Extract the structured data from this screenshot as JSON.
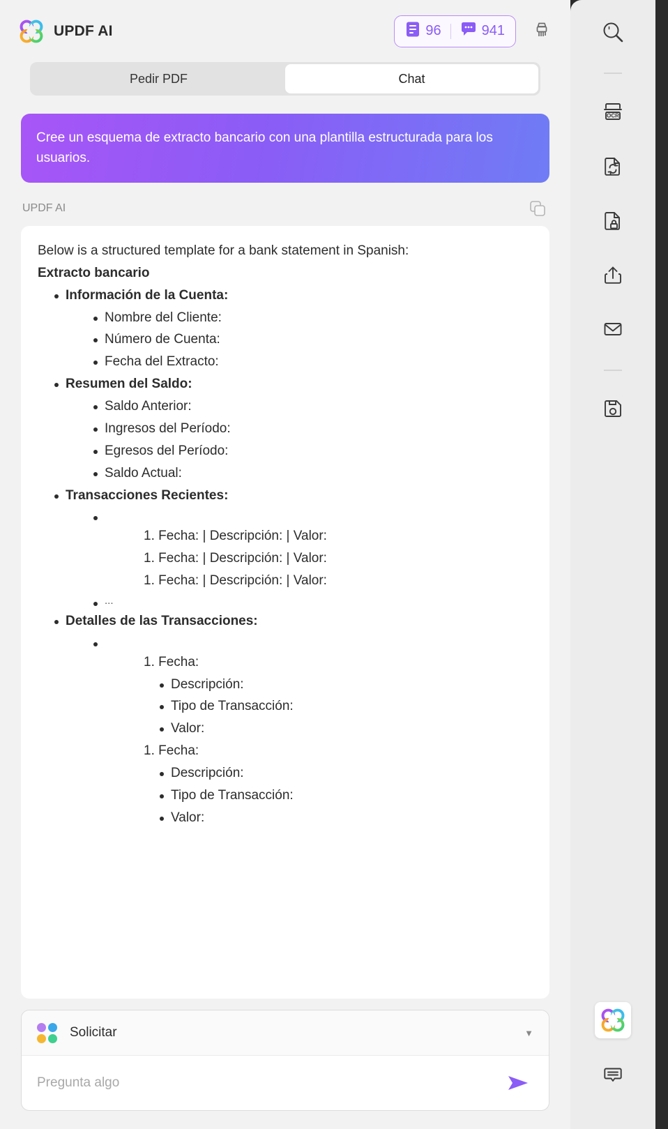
{
  "header": {
    "brand_title": "UPDF AI",
    "logo_icon": "updf-flower-logo",
    "pages_count": "96",
    "pages_icon": "document-pages-icon",
    "messages_count": "941",
    "messages_icon": "chat-bubble-icon",
    "brush_icon": "clear-brush-icon"
  },
  "tabs": [
    {
      "label": "Pedir PDF",
      "active": false
    },
    {
      "label": "Chat",
      "active": true
    }
  ],
  "conversation": {
    "user_message": "Cree un esquema de extracto bancario con una plantilla estructurada para los usuarios.",
    "response_author": "UPDF AI",
    "copy_icon": "copy-icon",
    "response": {
      "intro": "Below is a structured template for a bank statement in Spanish:",
      "heading": "Extracto bancario",
      "section1_title": "Información de la Cuenta:",
      "section1_items": [
        "Nombre del Cliente:",
        "Número de Cuenta:",
        "Fecha del Extracto:"
      ],
      "section2_title": "Resumen del Saldo:",
      "section2_items": [
        "Saldo Anterior:",
        "Ingresos del Período:",
        "Egresos del Período:",
        "Saldo Actual:"
      ],
      "section3_title": "Transacciones Recientes:",
      "section3_rows": [
        "1. Fecha: | Descripción: | Valor:",
        "1. Fecha: | Descripción: | Valor:",
        "1. Fecha: | Descripción: | Valor:"
      ],
      "section3_ellipsis": "...",
      "section4_title": "Detalles de las Transacciones:",
      "section4_entry1_date": "1. Fecha:",
      "section4_entry1_items": [
        "Descripción:",
        "Tipo de Transacción:",
        "Valor:"
      ],
      "section4_entry2_date": "1. Fecha:",
      "section4_entry2_items": [
        "Descripción:",
        "Tipo de Transacción:",
        "Valor:"
      ]
    }
  },
  "composer": {
    "mode_label": "Solicitar",
    "mode_icon": "four-dots-icon",
    "caret_icon": "chevron-down-icon",
    "input_placeholder": "Pregunta algo",
    "input_value": "",
    "send_icon": "send-arrow-icon"
  },
  "toolbar": {
    "items": [
      {
        "name": "search-icon",
        "label": "Search"
      },
      {
        "name": "ocr-icon",
        "label": "OCR"
      },
      {
        "name": "convert-document-icon",
        "label": "Convert"
      },
      {
        "name": "protect-document-icon",
        "label": "Protect"
      },
      {
        "name": "share-icon",
        "label": "Share"
      },
      {
        "name": "email-icon",
        "label": "Email"
      },
      {
        "name": "save-icon",
        "label": "Save"
      }
    ],
    "ocr_label": "OCR",
    "ai_button_icon": "updf-flower-logo",
    "comment_icon": "comment-icon"
  },
  "colors": {
    "accent_purple": "#8b5cf6",
    "bubble_gradient_start": "#a855f7",
    "bubble_gradient_end": "#6f7cf5",
    "panel_bg": "#f2f2f2",
    "rail_bg": "#ececec"
  }
}
